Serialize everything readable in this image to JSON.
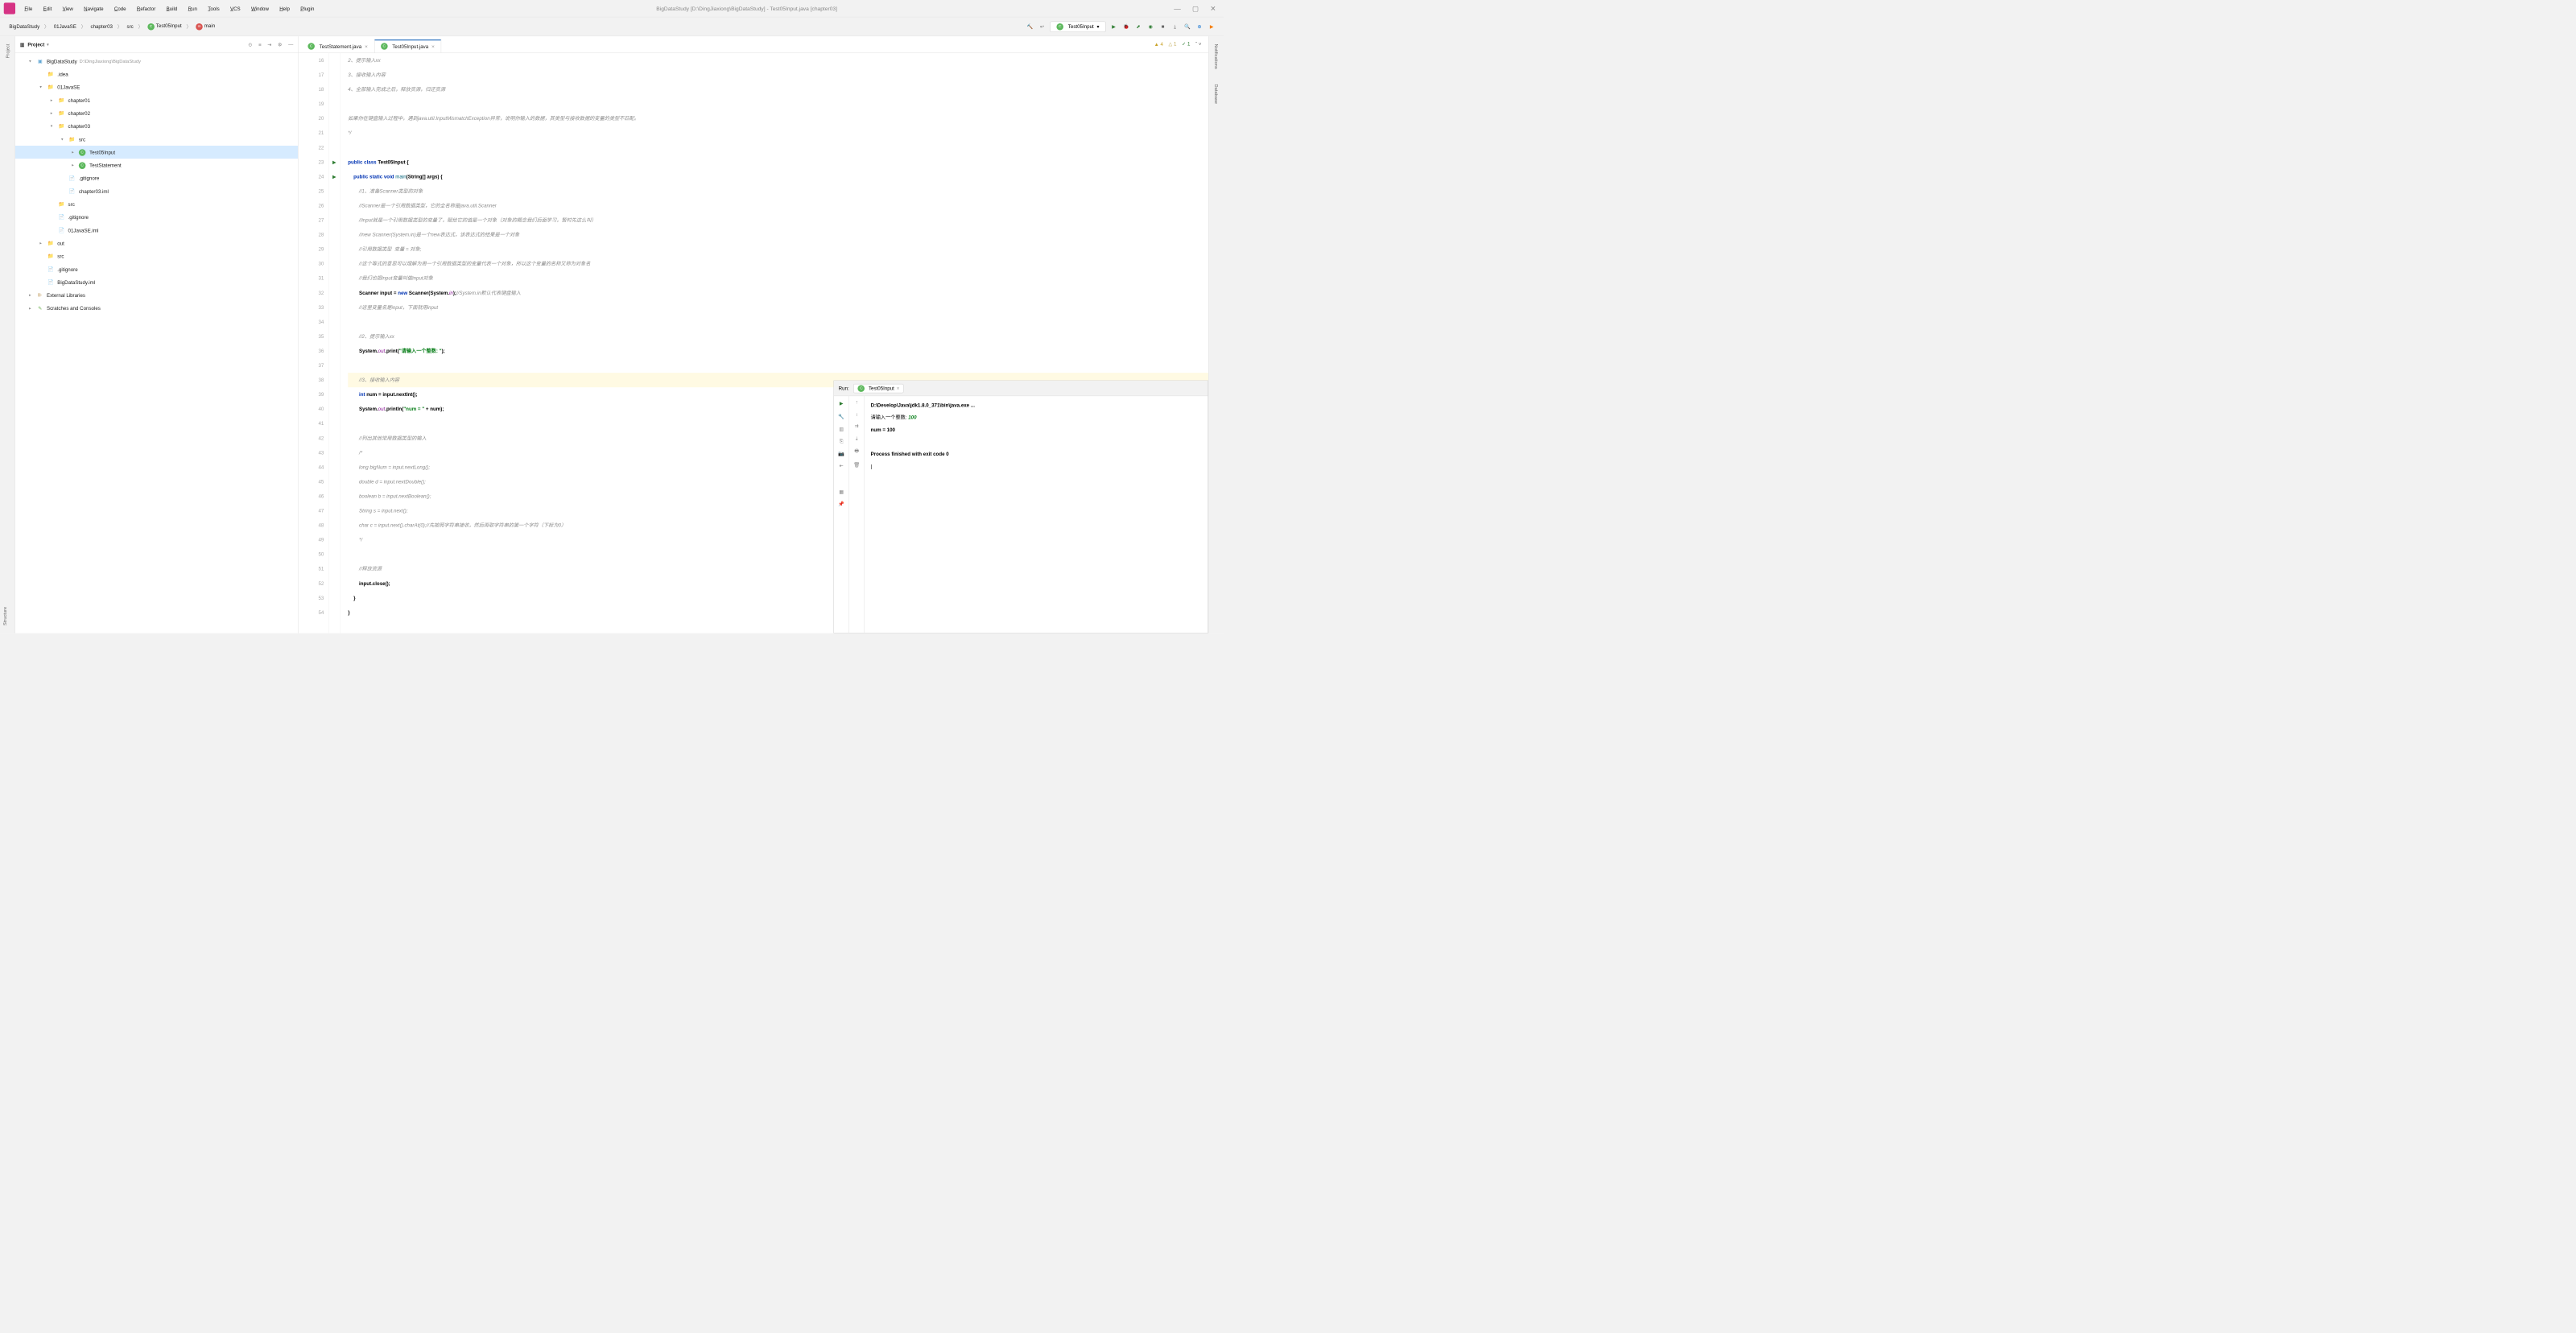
{
  "window": {
    "title": "BigDataStudy [D:\\DingJiaxiong\\BigDataStudy] - Test05Input.java [chapter03]"
  },
  "menu": [
    "File",
    "Edit",
    "View",
    "Navigate",
    "Code",
    "Refactor",
    "Build",
    "Run",
    "Tools",
    "VCS",
    "Window",
    "Help",
    "Plugin"
  ],
  "breadcrumbs": [
    "BigDataStudy",
    "01JavaSE",
    "chapter03",
    "src",
    "Test05Input",
    "main"
  ],
  "run_config": "Test05Input",
  "project_header": "Project",
  "inspections": {
    "warnings": "4",
    "weak": "1",
    "typos": "1"
  },
  "tree": {
    "root": {
      "name": "BigDataStudy",
      "path": "D:\\DingJiaxiong\\BigDataStudy"
    },
    "items": [
      {
        "indent": 1,
        "arrow": "▾",
        "icon": "folder-root",
        "label": "BigDataStudy",
        "suffix": "D:\\DingJiaxiong\\BigDataStudy"
      },
      {
        "indent": 2,
        "arrow": "",
        "icon": "folder",
        "label": ".idea"
      },
      {
        "indent": 2,
        "arrow": "▾",
        "icon": "folder",
        "label": "01JavaSE"
      },
      {
        "indent": 3,
        "arrow": "▸",
        "icon": "folder",
        "label": "chapter01"
      },
      {
        "indent": 3,
        "arrow": "▸",
        "icon": "folder",
        "label": "chapter02"
      },
      {
        "indent": 3,
        "arrow": "▾",
        "icon": "folder",
        "label": "chapter03"
      },
      {
        "indent": 4,
        "arrow": "▾",
        "icon": "folder-src",
        "label": "src"
      },
      {
        "indent": 5,
        "arrow": "▸",
        "icon": "class",
        "label": "Test05Input",
        "selected": true
      },
      {
        "indent": 5,
        "arrow": "▸",
        "icon": "class",
        "label": "TestStatement"
      },
      {
        "indent": 4,
        "arrow": "",
        "icon": "file",
        "label": ".gitignore"
      },
      {
        "indent": 4,
        "arrow": "",
        "icon": "file",
        "label": "chapter03.iml"
      },
      {
        "indent": 3,
        "arrow": "",
        "icon": "folder-src",
        "label": "src"
      },
      {
        "indent": 3,
        "arrow": "",
        "icon": "file",
        "label": ".gitignore"
      },
      {
        "indent": 3,
        "arrow": "",
        "icon": "file",
        "label": "01JavaSE.iml"
      },
      {
        "indent": 2,
        "arrow": "▸",
        "icon": "folder-out",
        "label": "out"
      },
      {
        "indent": 2,
        "arrow": "",
        "icon": "folder-src",
        "label": "src"
      },
      {
        "indent": 2,
        "arrow": "",
        "icon": "file",
        "label": ".gitignore"
      },
      {
        "indent": 2,
        "arrow": "",
        "icon": "file",
        "label": "BigDataStudy.iml"
      },
      {
        "indent": 1,
        "arrow": "▸",
        "icon": "lib",
        "label": "External Libraries"
      },
      {
        "indent": 1,
        "arrow": "▸",
        "icon": "scratch",
        "label": "Scratches and Consoles"
      }
    ]
  },
  "tabs": [
    {
      "label": "TestStatement.java",
      "active": false
    },
    {
      "label": "Test05Input.java",
      "active": true
    }
  ],
  "editor_lines": [
    {
      "n": 16,
      "html": "<span class='cmt'>2、提示输入xx</span>"
    },
    {
      "n": 17,
      "html": "<span class='cmt'>3、接收输入内容</span>"
    },
    {
      "n": 18,
      "html": "<span class='cmt'>4、全部输入完成之后，释放资源，归还资源</span>"
    },
    {
      "n": 19,
      "html": ""
    },
    {
      "n": 20,
      "html": "<span class='cmt'>如果你在键盘输入过程中，遇到</span><span class='cmt'>java.util.InputMismatchException</span><span class='cmt'>异常，说明你输入的数据，其类型与接收数据的变量的类型不匹配。</span>"
    },
    {
      "n": 21,
      "html": "<span class='cmt'>*/</span>"
    },
    {
      "n": 22,
      "html": ""
    },
    {
      "n": 23,
      "run": true,
      "html": "<span class='kw'>public class</span> <b>Test05Input {</b>"
    },
    {
      "n": 24,
      "run": true,
      "html": "    <span class='kw'>public static void</span> <span class='mtd'>main</span><b>(String[] args) {</b>"
    },
    {
      "n": 25,
      "html": "        <span class='cmt'>//1、准备Scanner类型的对象</span>"
    },
    {
      "n": 26,
      "html": "        <span class='cmt'>//Scanner是一个引用数据类型，它的全名称是java.util.Scanner</span>"
    },
    {
      "n": 27,
      "html": "        <span class='cmt'>//input就是一个引用数据类型的变量了，赋给它的值是一个对象（对象的概念我们后面学习，暂时先这么叫）</span>"
    },
    {
      "n": 28,
      "html": "        <span class='cmt'>//new Scanner(System.in)是一个new表达式，该表达式的结果是一个对象</span>"
    },
    {
      "n": 29,
      "html": "        <span class='cmt'>//引用数据类型  变量 = 对象;</span>"
    },
    {
      "n": 30,
      "html": "        <span class='cmt'>//这个等式的意思可以理解为用一个引用数据类型的变量代表一个对象，所以这个变量的名称又称为对象名</span>"
    },
    {
      "n": 31,
      "html": "        <span class='cmt'>//我们也把input变量叫做input对象</span>"
    },
    {
      "n": 32,
      "html": "        <b>Scanner input = </b><span class='kw'>new</span><b> Scanner(System.</b><span class='fld'>in</span><b>);</b><span class='cmt'>//System.in默认代表键盘输入</span>"
    },
    {
      "n": 33,
      "html": "        <span class='cmt'>//这里变量名是input，下面就用input</span>"
    },
    {
      "n": 34,
      "html": ""
    },
    {
      "n": 35,
      "html": "        <span class='cmt'>//2、提示输入xx</span>"
    },
    {
      "n": 36,
      "html": "        <b>System.</b><span class='fld'>out</span><b>.print(</b><span class='str'>\"请输入一个整数: \"</span><b>);</b>"
    },
    {
      "n": 37,
      "html": ""
    },
    {
      "n": 38,
      "hl": true,
      "html": "        <span class='cmt'>//3、接收输入内容</span>"
    },
    {
      "n": 39,
      "html": "        <span class='kw'>int</span><b> num = input.nextInt();</b>"
    },
    {
      "n": 40,
      "html": "        <b>System.</b><span class='fld'>out</span><b>.println(</b><span class='str'>\"num = \"</span><b> + num);</b>"
    },
    {
      "n": 41,
      "html": ""
    },
    {
      "n": 42,
      "html": "        <span class='cmt'>//列出其他常用数据类型的输入</span>"
    },
    {
      "n": 43,
      "html": "        <span class='cmt'>/*</span>"
    },
    {
      "n": 44,
      "html": "        <span class='cmt'>long bigNum = input.nextLong();</span>"
    },
    {
      "n": 45,
      "html": "        <span class='cmt'>double d = input.nextDouble();</span>"
    },
    {
      "n": 46,
      "html": "        <span class='cmt'>boolean b = input.nextBoolean();</span>"
    },
    {
      "n": 47,
      "html": "        <span class='cmt'>String s = input.next();</span>"
    },
    {
      "n": 48,
      "html": "        <span class='cmt'>char c = input.next().charAt(0);//先按照字符串接收，然后再取字符串的第一个字符（下标为0）</span>"
    },
    {
      "n": 49,
      "html": "        <span class='cmt'>*/</span>"
    },
    {
      "n": 50,
      "html": ""
    },
    {
      "n": 51,
      "html": "        <span class='cmt'>//释放资源</span>"
    },
    {
      "n": 52,
      "html": "        <b>input.close();</b>"
    },
    {
      "n": 53,
      "html": "    <b>}</b>"
    },
    {
      "n": 54,
      "html": "<b>}</b>"
    }
  ],
  "run": {
    "label": "Run:",
    "tab": "Test05Input",
    "output": [
      {
        "html": "<span class='bold'>D:\\Develop\\Java\\jdk1.8.0_371\\bin\\java.exe ...</span>"
      },
      {
        "html": "请输入一个整数: <span class='green'>100</span>"
      },
      {
        "html": "<span class='bold'>num = 100</span>"
      },
      {
        "html": ""
      },
      {
        "html": "<span class='bold'>Process finished with exit code 0</span>"
      },
      {
        "html": "|"
      }
    ]
  },
  "sidebars": {
    "project": "Project",
    "structure": "Structure",
    "notifications": "Notifications",
    "database": "Database"
  }
}
